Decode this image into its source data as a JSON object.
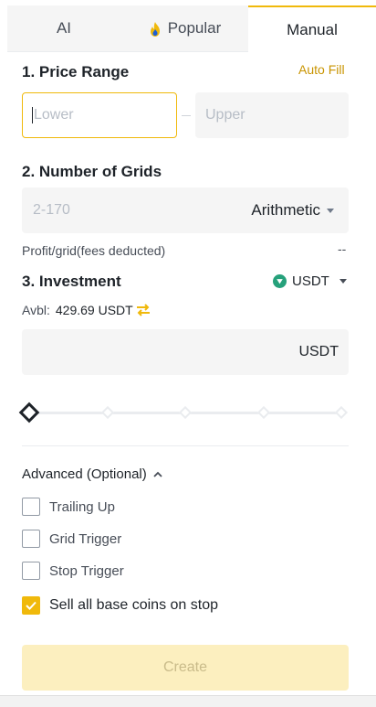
{
  "tabs": {
    "ai": "AI",
    "popular": "Popular",
    "manual": "Manual"
  },
  "price_range": {
    "title": "1. Price Range",
    "auto_fill": "Auto Fill",
    "lower_placeholder": "Lower",
    "upper_placeholder": "Upper"
  },
  "grids": {
    "title": "2. Number of Grids",
    "placeholder": "2-170",
    "mode": "Arithmetic"
  },
  "profit": {
    "label": "Profit/grid(fees deducted)",
    "value": "--"
  },
  "investment": {
    "title": "3. Investment",
    "currency": "USDT",
    "avbl_label": "Avbl:",
    "avbl_value": "429.69 USDT",
    "input_unit": "USDT",
    "slider_percent": 0
  },
  "advanced": {
    "title": "Advanced (Optional)",
    "options": [
      {
        "label": "Trailing Up",
        "checked": false
      },
      {
        "label": "Grid Trigger",
        "checked": false
      },
      {
        "label": "Stop Trigger",
        "checked": false
      },
      {
        "label": "Sell all base coins on stop",
        "checked": true
      }
    ]
  },
  "create_button": "Create",
  "colors": {
    "accent": "#f0b90b",
    "link": "#c99400",
    "usdt": "#26a17b"
  }
}
